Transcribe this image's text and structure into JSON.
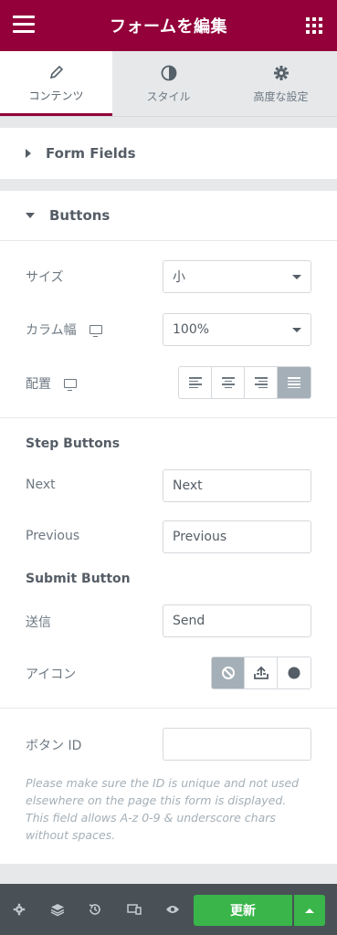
{
  "header": {
    "title": "フォームを編集"
  },
  "tabs": [
    {
      "label": "コンテンツ",
      "icon": "pencil-icon",
      "active": true
    },
    {
      "label": "スタイル",
      "icon": "contrast-icon",
      "active": false
    },
    {
      "label": "高度な設定",
      "icon": "gear-icon",
      "active": false
    }
  ],
  "sections": {
    "form_fields": "Form Fields",
    "buttons": "Buttons"
  },
  "buttons": {
    "size_label": "サイズ",
    "size_value": "小",
    "column_width_label": "カラム幅",
    "column_width_value": "100%",
    "alignment_label": "配置",
    "alignment_options": [
      "left",
      "center",
      "right",
      "justify"
    ],
    "alignment_selected": "justify",
    "step_buttons_heading": "Step Buttons",
    "next_label": "Next",
    "next_value": "Next",
    "previous_label": "Previous",
    "previous_value": "Previous",
    "submit_heading": "Submit Button",
    "send_label": "送信",
    "send_value": "Send",
    "icon_label": "アイコン",
    "icon_options": [
      "none-icon",
      "upload-icon",
      "circle-icon"
    ],
    "icon_selected": "none-icon",
    "button_id_label": "ボタン ID",
    "button_id_value": "",
    "help_text": "Please make sure the ID is unique and not used elsewhere on the page this form is displayed. This field allows A-z  0-9 & underscore chars without spaces."
  },
  "footer": {
    "update_label": "更新",
    "icons": [
      "settings-icon",
      "layers-icon",
      "history-icon",
      "responsive-icon",
      "preview-icon"
    ]
  },
  "colors": {
    "brand": "#93003a",
    "update_green": "#39b54a",
    "footer_bg": "#495157"
  }
}
